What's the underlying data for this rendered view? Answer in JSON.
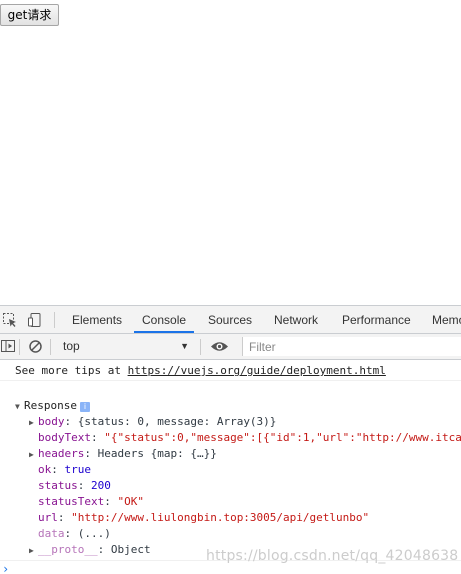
{
  "page": {
    "button_label": "get请求"
  },
  "devtools": {
    "tabs": [
      {
        "label": "Elements",
        "active": false
      },
      {
        "label": "Console",
        "active": true
      },
      {
        "label": "Sources",
        "active": false
      },
      {
        "label": "Network",
        "active": false
      },
      {
        "label": "Performance",
        "active": false
      },
      {
        "label": "Memo",
        "active": false
      }
    ],
    "context": "top",
    "filter_placeholder": "Filter",
    "accent_color": "#1a73e8"
  },
  "console": {
    "tip_prefix": "See more tips at ",
    "tip_link": "https://vuejs.org/guide/deployment.html",
    "object_name": "Response",
    "info_badge": "i",
    "properties": {
      "body": {
        "key": "body",
        "value": "{status: 0, message: Array(3)}"
      },
      "bodyText": {
        "key": "bodyText",
        "value": "\"{\"status\":0,\"message\":[{\"id\":1,\"url\":\"http://www.itca"
      },
      "headers": {
        "key": "headers",
        "value": "Headers {map: {…}}"
      },
      "ok": {
        "key": "ok",
        "value": "true"
      },
      "status": {
        "key": "status",
        "value": "200"
      },
      "statusText": {
        "key": "statusText",
        "value": "\"OK\""
      },
      "url": {
        "key": "url",
        "value": "\"http://www.liulongbin.top:3005/api/getlunbo\""
      },
      "data": {
        "key": "data",
        "value": "(...)"
      },
      "proto": {
        "key": "__proto__",
        "value": "Object"
      }
    },
    "prompt": "›"
  },
  "watermark": "https://blog.csdn.net/qq_42048638"
}
